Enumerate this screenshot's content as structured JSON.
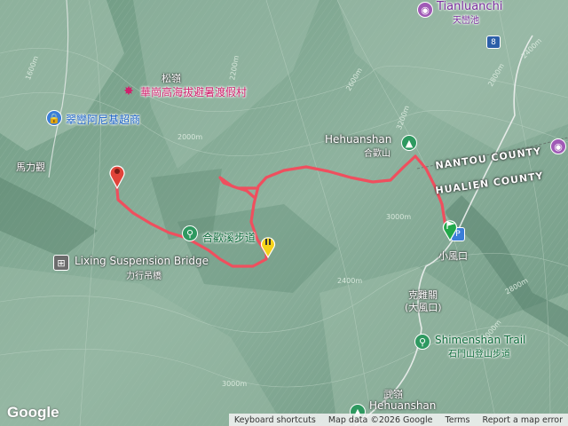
{
  "map": {
    "places": {
      "tianluanchi_en": "Tianluanchi",
      "tianluanchi_zh": "天巒池",
      "hehuanshan_en": "Hehuanshan",
      "hehuanshan_zh": "合歡山",
      "songling": "松嶺",
      "huagang": "華崗高海拔避暑渡假村",
      "cuiluan": "翠巒阿尼基超商",
      "malili": "馬力觀",
      "hehuan_creek": "合歡溪步道",
      "lixing_en": "Lixing Suspension Bridge",
      "lixing_zh": "力行吊橋",
      "xiaofengkou": "小風口",
      "kelaiguan": "克難關",
      "dafengkou": "(大風口)",
      "shimenshan_en": "Shimenshan Trail",
      "shimenshan_zh": "石門山登山步道",
      "wuling": "武嶺",
      "hehuanshan_bottom": "Hehuanshan",
      "route_badge": "8"
    },
    "counties": {
      "nantou": "NANTOU COUNTY",
      "hualien": "HUALIEN COUNTY"
    },
    "contours": [
      "1600m",
      "2000m",
      "2200m",
      "2400m",
      "2600m",
      "2800m",
      "3000m",
      "3200m",
      "2000m",
      "2400m",
      "2800m",
      "3000m"
    ],
    "route_color": "#ef4f5e",
    "markers": {
      "start_color": "#e0443a",
      "mid_color": "#f5d21a",
      "end_color": "#22a84a"
    }
  },
  "footer": {
    "logo": "Google",
    "shortcuts": "Keyboard shortcuts",
    "map_data": "Map data ©2026 Google",
    "terms": "Terms",
    "report": "Report a map error"
  }
}
